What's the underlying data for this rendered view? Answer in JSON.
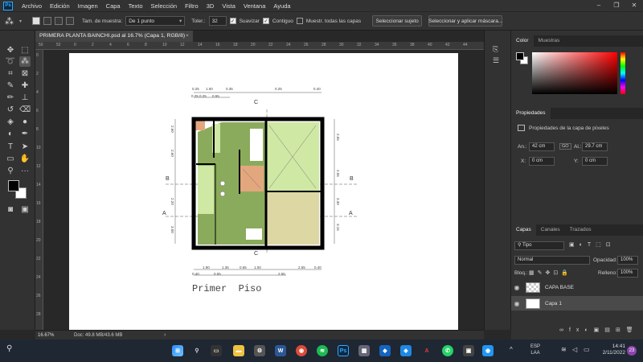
{
  "menu": {
    "logo": "Ps",
    "items": [
      "Archivo",
      "Edición",
      "Imagen",
      "Capa",
      "Texto",
      "Selección",
      "Filtro",
      "3D",
      "Vista",
      "Ventana",
      "Ayuda"
    ],
    "window_controls": [
      "–",
      "❐",
      "✕"
    ]
  },
  "options": {
    "sample_size_label": "Tam. de muestra:",
    "sample_size_value": "De 1 punto",
    "tolerance_label": "Toler.:",
    "tolerance_value": "32",
    "smooth_label": "Suavizar",
    "contiguous_label": "Contiguo",
    "sample_all_label": "Muestr. todas las capas",
    "select_subject": "Seleccionar sujeto",
    "select_mask": "Seleccionar y aplicar máscara..."
  },
  "document": {
    "tab_title": "PRIMERA PLANTA BAINCHI.psd al 16.7% (Capa 1, RGB/8)",
    "tab_close": "×",
    "plan_title": "Primer  Piso"
  },
  "ruler_h": [
    "50",
    "52",
    "0",
    "2",
    "4",
    "6",
    "8",
    "10",
    "12",
    "14",
    "16",
    "18",
    "20",
    "22",
    "24",
    "26",
    "28",
    "30",
    "32",
    "34",
    "36",
    "38",
    "40",
    "42",
    "44"
  ],
  "ruler_v": [
    "0",
    "2",
    "4",
    "6",
    "8",
    "10",
    "12",
    "14",
    "16",
    "18",
    "20",
    "22",
    "24",
    "26",
    "28"
  ],
  "plan": {
    "dims_top_1": [
      "0.25",
      "1.00",
      "0.35",
      "0.25",
      "0.40"
    ],
    "dims_top_2": [
      "0.25 0.25",
      "0.55"
    ],
    "dims_bottom_1": [
      "1.90",
      "1.35",
      "0.65",
      "1.00",
      "2.55",
      "0.40"
    ],
    "dims_bottom_2": [
      "0.40",
      "0.55",
      "2.55"
    ],
    "dims_left": [
      "2.60",
      "2.60",
      "2.20",
      "3.00"
    ],
    "dims_right": [
      "2.65",
      "2.55",
      "3.30",
      "3.15"
    ],
    "axis_c": "C",
    "axis_b": "B",
    "axis_a": "A"
  },
  "status": {
    "zoom": "16.67%",
    "doc_info": "Doc: 49.8 MB/43.6 MB",
    "arrow": "›"
  },
  "panels": {
    "color_tabs": [
      "Color",
      "Muestras"
    ],
    "properties_tab": "Propiedades",
    "properties_title": "Propiedades de la capa de píxeles",
    "w_label": "An.:",
    "w_value": "42 cm",
    "link_label": "GO",
    "h_label": "Al.:",
    "h_value": "29.7 cm",
    "x_label": "X:",
    "x_value": "0 cm",
    "y_label": "Y:",
    "y_value": "0 cm",
    "layer_tabs": [
      "Capas",
      "Canales",
      "Trazados"
    ],
    "kind_label": "Tipo",
    "blend_mode": "Normal",
    "opacity_label": "Opacidad:",
    "opacity_value": "100%",
    "lock_label": "Bloq.:",
    "fill_label": "Relleno:",
    "fill_value": "100%",
    "layers": [
      "CAPA BASE",
      "Capa 1"
    ]
  },
  "taskbar": {
    "lang_1": "ESP",
    "lang_2": "LAA",
    "time": "14:41",
    "date": "2/11/2022",
    "notif": "23"
  },
  "colors": {
    "green_dark": "#8bab5c",
    "green_light": "#cfe8a4",
    "beige": "#ddd7a4",
    "orange": "#e3a77e",
    "wall": "#000000",
    "accent": "#31a8ff"
  }
}
